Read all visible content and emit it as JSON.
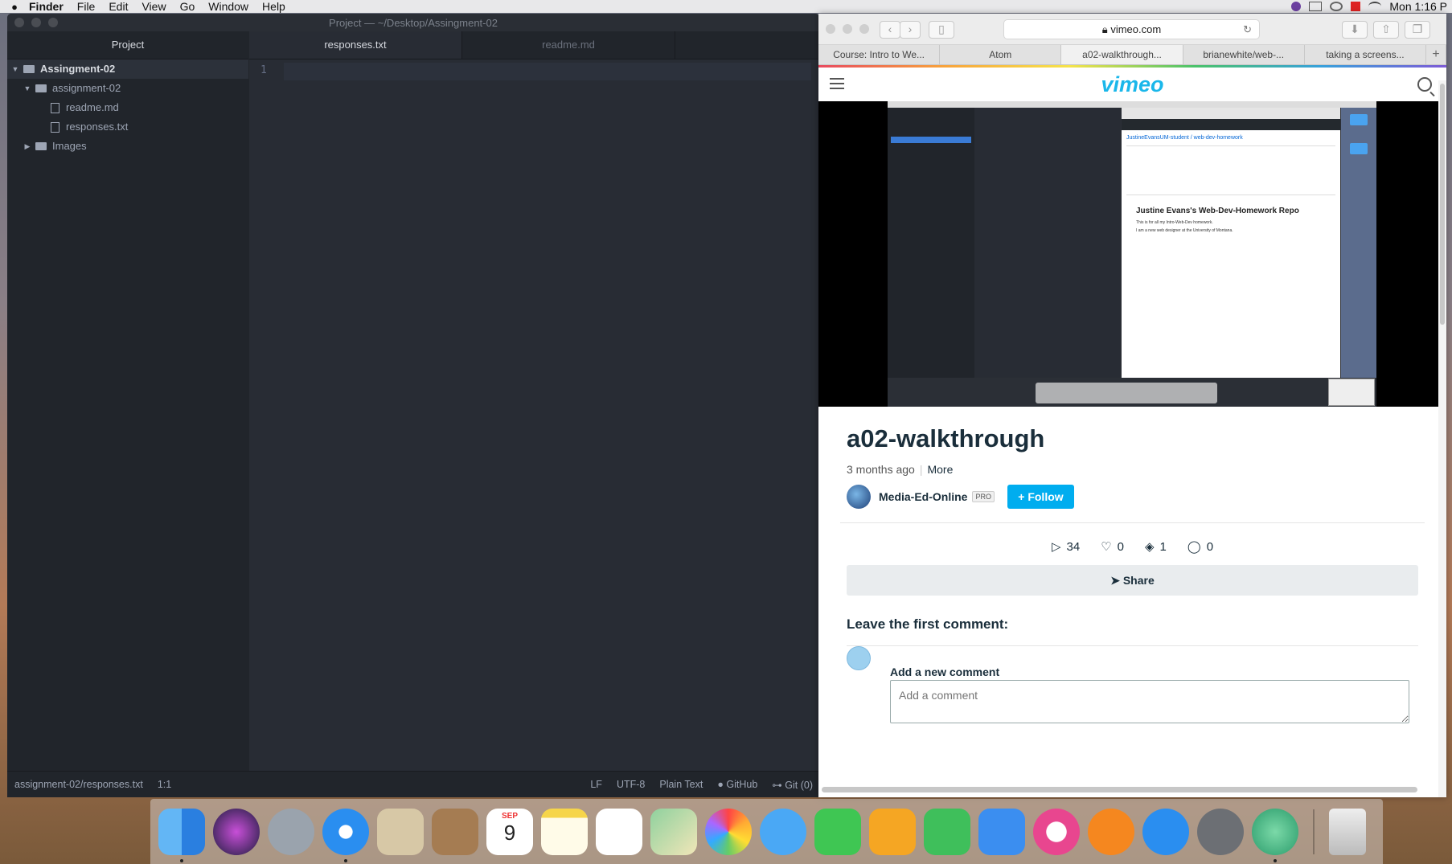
{
  "menubar": {
    "app": "Finder",
    "items": [
      "File",
      "Edit",
      "View",
      "Go",
      "Window",
      "Help"
    ],
    "clock": "Mon 1:16 P"
  },
  "atom": {
    "window_title": "Project — ~/Desktop/Assingment-02",
    "tree_header": "Project",
    "tree": {
      "root": "Assingment-02",
      "folder": "assignment-02",
      "file1": "readme.md",
      "file2": "responses.txt",
      "images": "Images"
    },
    "tabs": [
      "responses.txt",
      "readme.md"
    ],
    "line_number": "1",
    "status": {
      "path": "assignment-02/responses.txt",
      "cursor": "1:1",
      "line_ending": "LF",
      "encoding": "UTF-8",
      "grammar": "Plain Text",
      "github": "GitHub",
      "git": "Git (0)"
    }
  },
  "safari": {
    "url": "vimeo.com",
    "tabs": [
      "Course: Intro to We...",
      "Atom",
      "a02-walkthrough...",
      "brianewhite/web-...",
      "taking a screens..."
    ],
    "active_tab_index": 2,
    "logo": "vimeo",
    "embedded_screenshot": {
      "repo_path": "JustineEvansUM-student / web-dev-homework",
      "readme_title": "Justine Evans's Web-Dev-Homework Repo",
      "readme_line1": "This is for all my Intro-Web-Dev homework.",
      "readme_line2": "I am a new web designer at the University of Montana."
    },
    "video": {
      "title": "a02-walkthrough",
      "age": "3 months ago",
      "more": "More",
      "owner": "Media-Ed-Online",
      "badge": "PRO",
      "follow": "+ Follow",
      "plays": "34",
      "likes": "0",
      "collections": "1",
      "comments": "0",
      "share": "Share"
    },
    "comments": {
      "lead": "Leave the first comment:",
      "label": "Add a new comment",
      "placeholder": "Add a comment"
    }
  },
  "colors": {
    "atom_bg": "#21252b",
    "editor_bg": "#282c34",
    "vimeo_blue": "#1ab7ea",
    "follow_blue": "#00adef"
  },
  "dock": {
    "calendar_month": "SEP",
    "calendar_day": "9",
    "icons": [
      "finder-icon",
      "siri-icon",
      "launchpad-icon",
      "safari-icon",
      "mail-icon",
      "contacts-icon",
      "calendar-icon",
      "notes-icon",
      "reminders-icon",
      "maps-icon",
      "photos-icon",
      "messages-icon",
      "facetime-icon",
      "pages-icon",
      "numbers-icon",
      "keynote-icon",
      "itunes-icon",
      "ibooks-icon",
      "app-store-icon",
      "system-preferences-icon",
      "atom-icon",
      "trash-icon"
    ]
  }
}
